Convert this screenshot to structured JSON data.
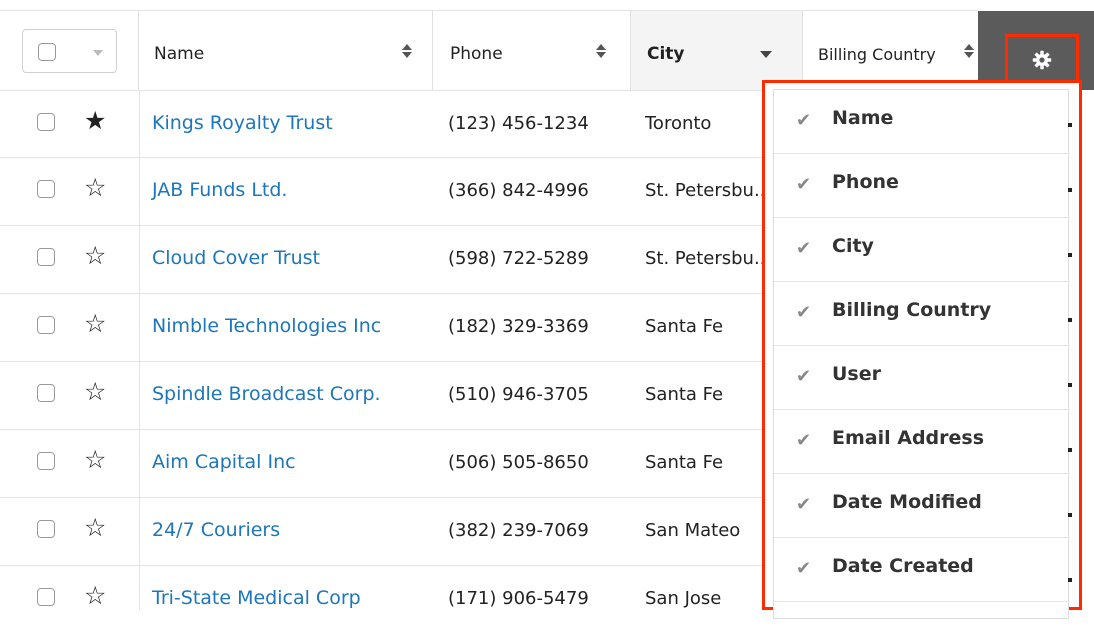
{
  "header": {
    "name_label": "Name",
    "phone_label": "Phone",
    "city_label": "City",
    "billing_country_label": "Billing Country"
  },
  "rows": [
    {
      "name": "Kings Royalty Trust",
      "phone": "(123) 456-1234",
      "city": "Toronto",
      "favorite": true
    },
    {
      "name": "JAB Funds Ltd.",
      "phone": "(366) 842-4996",
      "city": "St. Petersbu...",
      "favorite": false
    },
    {
      "name": "Cloud Cover Trust",
      "phone": "(598) 722-5289",
      "city": "St. Petersbu...",
      "favorite": false
    },
    {
      "name": "Nimble Technologies Inc",
      "phone": "(182) 329-3369",
      "city": "Santa Fe",
      "favorite": false
    },
    {
      "name": "Spindle Broadcast Corp.",
      "phone": "(510) 946-3705",
      "city": "Santa Fe",
      "favorite": false
    },
    {
      "name": "Aim Capital Inc",
      "phone": "(506) 505-8650",
      "city": "Santa Fe",
      "favorite": false
    },
    {
      "name": "24/7 Couriers",
      "phone": "(382) 239-7069",
      "city": "San Mateo",
      "favorite": false
    },
    {
      "name": "Tri-State Medical Corp",
      "phone": "(171) 906-5479",
      "city": "San Jose",
      "favorite": false
    }
  ],
  "column_menu": {
    "items": [
      {
        "label": "Name",
        "checked": true
      },
      {
        "label": "Phone",
        "checked": true
      },
      {
        "label": "City",
        "checked": true
      },
      {
        "label": "Billing Country",
        "checked": true
      },
      {
        "label": "User",
        "checked": true
      },
      {
        "label": "Email Address",
        "checked": true
      },
      {
        "label": "Date Modified",
        "checked": true
      },
      {
        "label": "Date Created",
        "checked": true
      }
    ]
  },
  "icons": {
    "star_filled": "★",
    "star_empty": "☆",
    "check": "✔",
    "gear": "gear-icon"
  },
  "colors": {
    "link": "#1d76bb",
    "highlight": "#ff2a00",
    "gear_bg": "#5b5b5b"
  }
}
